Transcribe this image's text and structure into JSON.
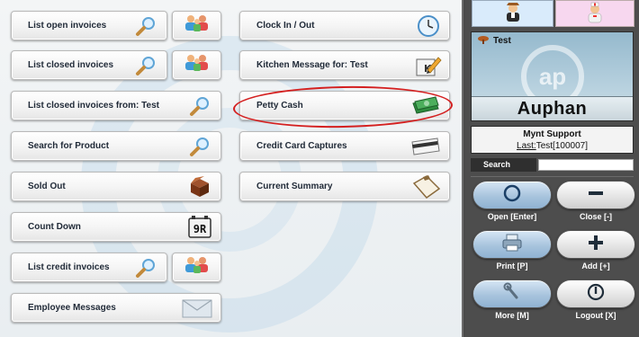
{
  "left_buttons": {
    "list_open_invoices": "List open invoices",
    "list_closed_invoices": "List closed invoices",
    "list_closed_invoices_from": "List closed invoices from: Test",
    "search_for_product": "Search for Product",
    "sold_out": "Sold Out",
    "count_down": "Count Down",
    "list_credit_invoices": "List credit invoices",
    "employee_messages": "Employee Messages"
  },
  "middle_buttons": {
    "clock_in_out": "Clock In / Out",
    "kitchen_message": "Kitchen Message for: Test",
    "petty_cash": "Petty Cash",
    "credit_card_captures": "Credit Card Captures",
    "current_summary": "Current Summary"
  },
  "count_down_display": "9R",
  "user_panel": {
    "user_name": "Test",
    "logo_text": "ap",
    "brand": "Auphan"
  },
  "info": {
    "name": "Mynt Support",
    "last_label": "Last:",
    "last_value": "Test[100007]"
  },
  "search": {
    "label": "Search",
    "value": ""
  },
  "actions": {
    "open": "Open [Enter]",
    "close": "Close [-]",
    "print": "Print [P]",
    "add": "Add [+]",
    "more": "More [M]",
    "logout": "Logout [X]"
  },
  "icons": {
    "magnifier": "magnifier-icon",
    "people": "people-icon",
    "clock": "clock-icon",
    "keyboard_pencil": "keyboard-pencil-icon",
    "money": "money-icon",
    "credit_card": "credit-card-icon",
    "box": "box-icon",
    "clipboard": "clipboard-icon",
    "envelope": "envelope-icon"
  },
  "colors": {
    "highlight": "#d42020",
    "accent_blue": "#8fb2d2"
  }
}
